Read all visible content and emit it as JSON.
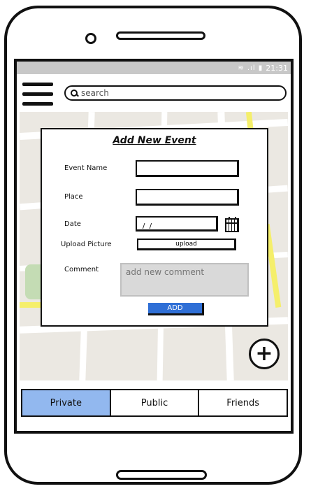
{
  "statusbar": {
    "time": "21:31",
    "icons": "wifi-signal-battery"
  },
  "search": {
    "placeholder": "search"
  },
  "dialog": {
    "title": "Add New Event",
    "fields": {
      "event_name_label": "Event Name",
      "event_name_value": "",
      "place_label": "Place",
      "place_value": "",
      "date_label": "Date",
      "date_value": "/  /",
      "upload_label": "Upload Picture",
      "upload_button": "upload",
      "comment_label": "Comment",
      "comment_placeholder": "add new comment"
    },
    "add_button": "ADD"
  },
  "fab": {
    "label": "+"
  },
  "tabs": [
    {
      "label": "Private",
      "active": true
    },
    {
      "label": "Public",
      "active": false
    },
    {
      "label": "Friends",
      "active": false
    }
  ],
  "colors": {
    "active_tab": "#92b8ef",
    "add_button": "#2f6fd6",
    "map_background": "#ebe8e2",
    "map_road_yellow": "#f5ef6b",
    "map_park": "#c4dcb4",
    "statusbar": "#c8c8c8"
  }
}
